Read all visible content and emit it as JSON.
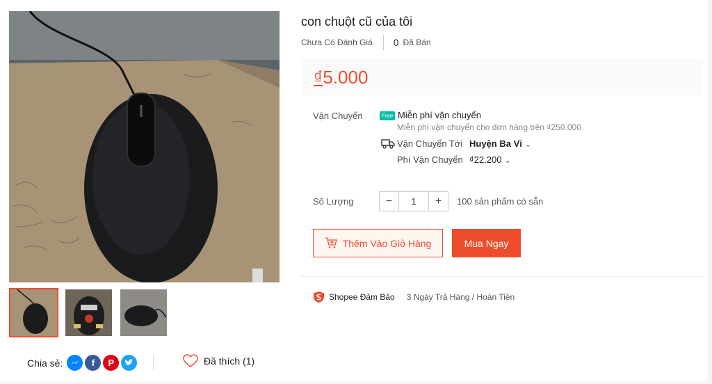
{
  "product": {
    "title": "con chuột cũ của tôi",
    "rating_text": "Chưa Có Đánh Giá",
    "sold_count": "0",
    "sold_label": "Đã Bán",
    "currency": "₫",
    "price": "5.000"
  },
  "shipping": {
    "label": "Vận Chuyển",
    "free_badge": "Free",
    "free_title": "Miễn phí vận chuyển",
    "free_note": "Miễn phí vận chuyển cho đơn hàng trên ₫250.000",
    "ship_to_label": "Vận Chuyển Tới",
    "ship_to_value": "Huyện Ba Vì",
    "fee_label": "Phí Vận Chuyển",
    "fee_value": "₫22.200"
  },
  "quantity": {
    "label": "Số Lượng",
    "value": "1",
    "minus": "−",
    "plus": "+",
    "stock_text": "100 sản phẩm có sẵn"
  },
  "actions": {
    "add_to_cart": "Thêm Vào Giỏ Hàng",
    "buy_now": "Mua Ngay"
  },
  "guarantee": {
    "title": "Shopee Đảm Bảo",
    "description": "3 Ngày Trả Hàng / Hoàn Tiền"
  },
  "share": {
    "label": "Chia sẻ:",
    "icons": [
      "messenger-icon",
      "facebook-icon",
      "pinterest-icon",
      "twitter-icon"
    ],
    "facebook_glyph": "f",
    "pinterest_glyph": "P"
  },
  "like": {
    "label": "Đã thích (1)"
  },
  "colors": {
    "accent": "#ee4d2d",
    "free_badge": "#00bfa5"
  }
}
